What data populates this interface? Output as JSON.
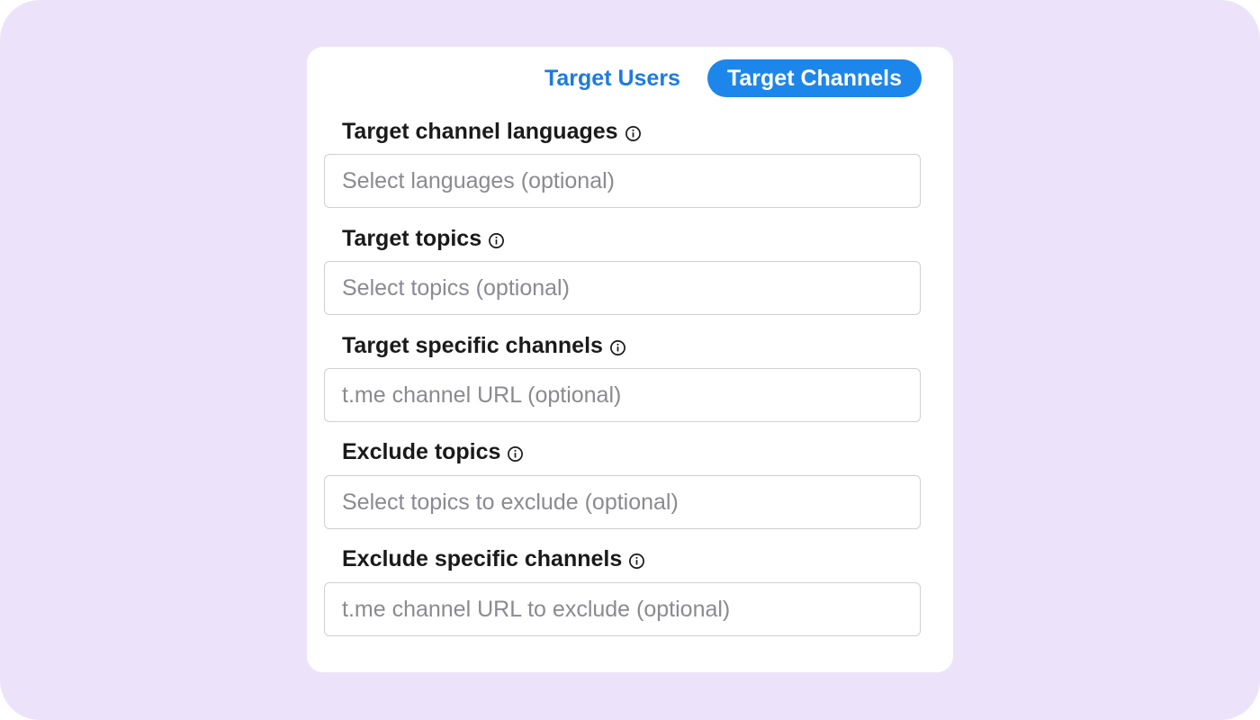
{
  "tabs": {
    "users_label": "Target Users",
    "channels_label": "Target Channels",
    "active": "Target Channels"
  },
  "fields": [
    {
      "label": "Target channel languages",
      "placeholder": "Select languages (optional)",
      "value": ""
    },
    {
      "label": "Target topics",
      "placeholder": "Select topics (optional)",
      "value": ""
    },
    {
      "label": "Target specific channels",
      "placeholder": "t.me channel URL (optional)",
      "value": ""
    },
    {
      "label": "Exclude topics",
      "placeholder": "Select topics to exclude (optional)",
      "value": ""
    },
    {
      "label": "Exclude specific channels",
      "placeholder": "t.me channel URL to exclude (optional)",
      "value": ""
    }
  ],
  "icons": {
    "label_hint": "info-icon"
  },
  "colors": {
    "background": "#ece3fa",
    "accent": "#1d86ea",
    "tab_text": "#1d7be0"
  }
}
